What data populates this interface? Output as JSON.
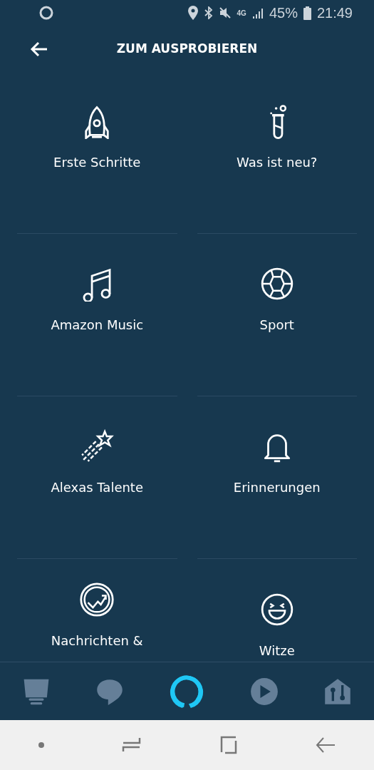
{
  "status_bar": {
    "network": "4G",
    "battery": "45%",
    "time": "21:49"
  },
  "header": {
    "title": "ZUM AUSPROBIEREN"
  },
  "tiles": [
    {
      "label": "Erste Schritte"
    },
    {
      "label": "Was ist neu?"
    },
    {
      "label": "Amazon Music"
    },
    {
      "label": "Sport"
    },
    {
      "label": "Alexas Talente"
    },
    {
      "label": "Erinnerungen"
    },
    {
      "label": "Nachrichten &"
    },
    {
      "label": "Witze"
    }
  ],
  "bottom_nav": [
    {
      "selected": false
    },
    {
      "selected": false
    },
    {
      "selected": true
    },
    {
      "selected": false
    },
    {
      "selected": false
    }
  ]
}
